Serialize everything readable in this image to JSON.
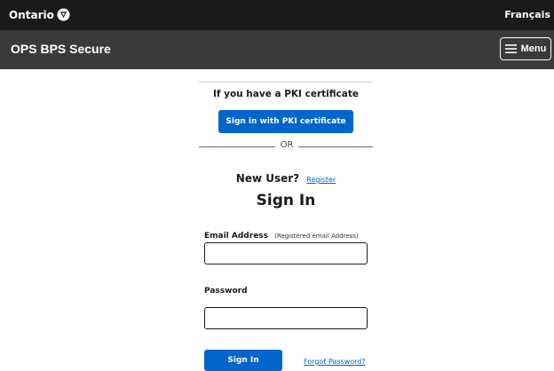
{
  "header": {
    "logo_text": "Ontario",
    "language_link": "Français"
  },
  "appbar": {
    "title": "OPS BPS Secure",
    "menu_label": "Menu"
  },
  "pki": {
    "label": "If you have a PKI certificate",
    "button_label": "Sign in with PKI certificate"
  },
  "divider": {
    "or_text": "OR"
  },
  "new_user": {
    "label": "New User?",
    "register_link": "Register"
  },
  "signin": {
    "heading": "Sign In",
    "email_label": "Email Address",
    "email_hint": "(Registered email Address)",
    "email_value": "",
    "password_label": "Password",
    "password_value": "",
    "button_label": "Sign In",
    "forgot_link": "Forgot Password?"
  },
  "colors": {
    "topbar": "#1a1a1a",
    "appbar": "#3a3a3a",
    "primary_button": "#0066cc",
    "link": "#0066cc"
  },
  "icons": {
    "logo": "trillium-icon",
    "menu": "hamburger-icon"
  }
}
